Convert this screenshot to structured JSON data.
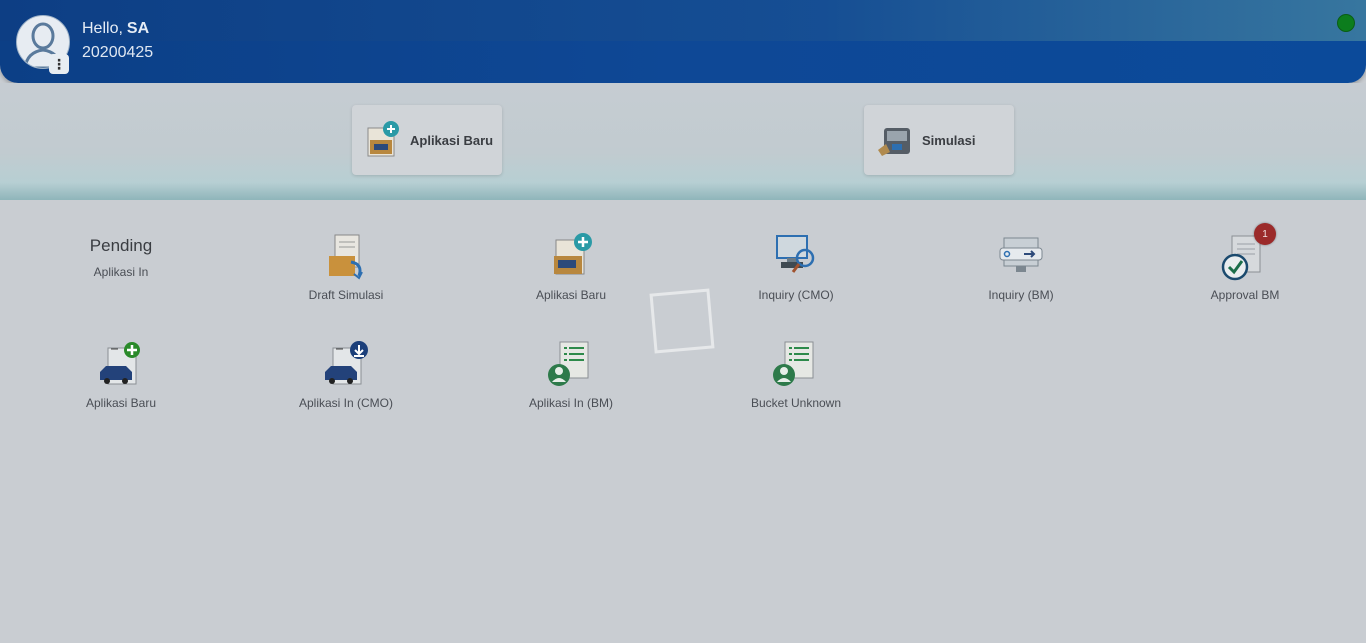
{
  "header": {
    "greeting_prefix": "Hello",
    "user_name": "SA",
    "user_id": "20200425",
    "status_color": "#0c7d1d",
    "accent": "#0e4896"
  },
  "quick_actions": [
    {
      "label": "Aplikasi Baru",
      "icon": "new-application-icon"
    },
    {
      "label": "Simulasi",
      "icon": "simulation-icon"
    }
  ],
  "menu": {
    "pending_title": "Pending",
    "pending_sub": "Aplikasi In",
    "items": [
      {
        "label": "Draft Simulasi",
        "icon": "draft-simulation-icon"
      },
      {
        "label": "Aplikasi Baru",
        "icon": "new-application-icon"
      },
      {
        "label": "Inquiry (CMO)",
        "icon": "inquiry-cmo-icon"
      },
      {
        "label": "Inquiry (BM)",
        "icon": "inquiry-bm-icon"
      },
      {
        "label": "Approval BM",
        "icon": "approval-icon",
        "badge": "1"
      },
      {
        "label": "Aplikasi Baru",
        "icon": "new-car-application-icon"
      },
      {
        "label": "Aplikasi In (CMO)",
        "icon": "application-in-cmo-icon"
      },
      {
        "label": "Aplikasi In (BM)",
        "icon": "application-in-bm-icon"
      },
      {
        "label": "Bucket Unknown",
        "icon": "bucket-unknown-icon"
      }
    ]
  }
}
